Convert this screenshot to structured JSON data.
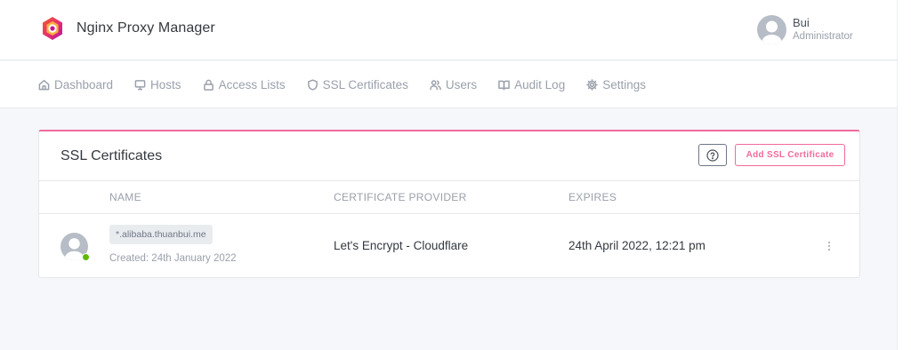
{
  "app": {
    "title": "Nginx Proxy Manager",
    "colors": {
      "accent": "#f06b9b",
      "success": "#5eba00",
      "muted": "#9aa0ac"
    }
  },
  "user": {
    "name": "Bui",
    "role": "Administrator",
    "icon": "avatar-icon"
  },
  "nav": {
    "items": [
      {
        "label": "Dashboard",
        "icon": "home-icon"
      },
      {
        "label": "Hosts",
        "icon": "monitor-icon"
      },
      {
        "label": "Access Lists",
        "icon": "lock-icon"
      },
      {
        "label": "SSL Certificates",
        "icon": "shield-icon"
      },
      {
        "label": "Users",
        "icon": "users-icon"
      },
      {
        "label": "Audit Log",
        "icon": "book-icon"
      },
      {
        "label": "Settings",
        "icon": "gear-icon"
      }
    ]
  },
  "card": {
    "title": "SSL Certificates",
    "help_icon": "help-circle-icon",
    "add_button": "Add SSL Certificate",
    "columns": [
      "NAME",
      "CERTIFICATE PROVIDER",
      "EXPIRES"
    ],
    "rows": [
      {
        "domain": "*.alibaba.thuanbui.me",
        "created": "Created: 24th January 2022",
        "provider": "Let's Encrypt - Cloudflare",
        "expires": "24th April 2022, 12:21 pm",
        "status": "online"
      }
    ]
  }
}
